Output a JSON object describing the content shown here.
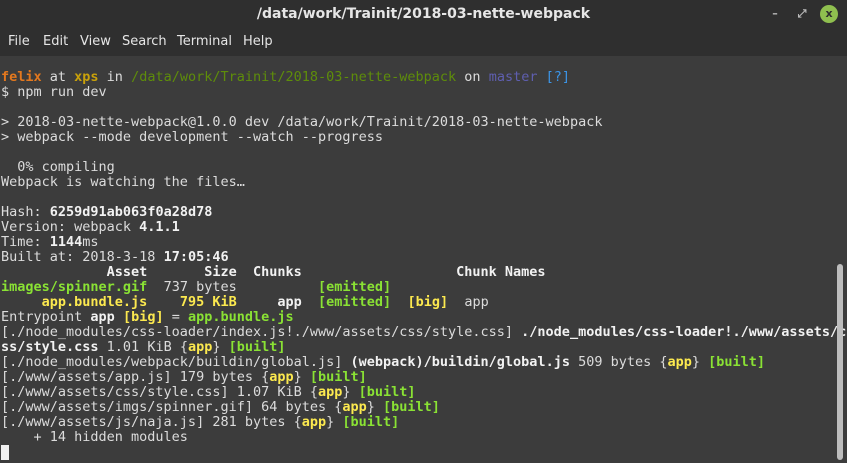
{
  "window": {
    "title": "/data/work/Trainit/2018-03-nette-webpack",
    "minimize": "–",
    "maximize": "⤢",
    "close": "x"
  },
  "menu": [
    "File",
    "Edit",
    "View",
    "Search",
    "Terminal",
    "Help"
  ],
  "colors": {
    "background": "#3c3c3c",
    "user": "#e3781e",
    "host": "#c9a10a",
    "path": "#5e8d0a",
    "branch": "#5f5fb0",
    "status": "#3b95e8",
    "green": "#8ae234",
    "yellow": "#fce94f"
  },
  "terminal": [
    [
      [
        "felix",
        "c-orange"
      ],
      [
        " at ",
        ""
      ],
      [
        "xps",
        "c-gold"
      ],
      [
        " in ",
        ""
      ],
      [
        "/data/work/Trainit/2018-03-nette-webpack",
        "c-path"
      ],
      [
        " on ",
        ""
      ],
      [
        "master",
        "c-purple"
      ],
      [
        " [?]",
        "c-blue"
      ]
    ],
    [
      [
        "$ npm run dev",
        ""
      ]
    ],
    [],
    [
      [
        "> 2018-03-nette-webpack@1.0.0 dev /data/work/Trainit/2018-03-nette-webpack",
        ""
      ]
    ],
    [
      [
        "> webpack --mode development --watch --progress",
        ""
      ]
    ],
    [],
    [
      [
        "  0% compiling",
        ""
      ]
    ],
    [
      [
        "Webpack is watching the files…",
        ""
      ]
    ],
    [],
    [
      [
        "Hash: ",
        ""
      ],
      [
        "6259d91ab063f0a28d78",
        "b"
      ]
    ],
    [
      [
        "Version: webpack ",
        ""
      ],
      [
        "4.1.1",
        "b"
      ]
    ],
    [
      [
        "Time: ",
        ""
      ],
      [
        "1144",
        "b"
      ],
      [
        "ms",
        ""
      ]
    ],
    [
      [
        "Built at: 2018-3-18 ",
        ""
      ],
      [
        "17:05:46",
        "b"
      ]
    ],
    [
      [
        "             Asset       Size  Chunks                   Chunk Names",
        "b"
      ]
    ],
    [
      [
        "images/spinner.gif",
        "c-greenb"
      ],
      [
        "  737 bytes          ",
        ""
      ],
      [
        "[emitted]",
        "c-greenb"
      ]
    ],
    [
      [
        "     app.bundle.js",
        "c-yellowb"
      ],
      [
        "    ",
        ""
      ],
      [
        "795 KiB",
        "c-yellowb"
      ],
      [
        "     ",
        ""
      ],
      [
        "app",
        "b"
      ],
      [
        "  ",
        ""
      ],
      [
        "[emitted]",
        "c-greenb"
      ],
      [
        "  ",
        ""
      ],
      [
        "[big]",
        "c-yellowb"
      ],
      [
        "  app",
        ""
      ]
    ],
    [
      [
        "Entrypoint ",
        ""
      ],
      [
        "app",
        "b"
      ],
      [
        " ",
        ""
      ],
      [
        "[big]",
        "c-yellowb"
      ],
      [
        " = ",
        ""
      ],
      [
        "app.bundle.js",
        "c-greenb"
      ]
    ],
    [
      [
        "[./node_modules/css-loader/index.js!./www/assets/css/style.css] ",
        ""
      ],
      [
        "./node_modules/css-loader!./www/assets/c",
        "b"
      ]
    ],
    [
      [
        "ss/style.css",
        "b"
      ],
      [
        " 1.01 KiB {",
        ""
      ],
      [
        "app",
        "c-yellowb"
      ],
      [
        "} ",
        ""
      ],
      [
        "[built]",
        "c-greenb"
      ]
    ],
    [
      [
        "[./node_modules/webpack/buildin/global.js] ",
        ""
      ],
      [
        "(webpack)/buildin/global.js",
        "b"
      ],
      [
        " 509 bytes {",
        ""
      ],
      [
        "app",
        "c-yellowb"
      ],
      [
        "} ",
        ""
      ],
      [
        "[built]",
        "c-greenb"
      ]
    ],
    [
      [
        "[./www/assets/app.js] 179 bytes {",
        ""
      ],
      [
        "app",
        "c-yellowb"
      ],
      [
        "} ",
        ""
      ],
      [
        "[built]",
        "c-greenb"
      ]
    ],
    [
      [
        "[./www/assets/css/style.css] 1.07 KiB {",
        ""
      ],
      [
        "app",
        "c-yellowb"
      ],
      [
        "} ",
        ""
      ],
      [
        "[built]",
        "c-greenb"
      ]
    ],
    [
      [
        "[./www/assets/imgs/spinner.gif] 64 bytes {",
        ""
      ],
      [
        "app",
        "c-yellowb"
      ],
      [
        "} ",
        ""
      ],
      [
        "[built]",
        "c-greenb"
      ]
    ],
    [
      [
        "[./www/assets/js/naja.js] 281 bytes {",
        ""
      ],
      [
        "app",
        "c-yellowb"
      ],
      [
        "} ",
        ""
      ],
      [
        "[built]",
        "c-greenb"
      ]
    ],
    [
      [
        "    + 14 hidden modules",
        ""
      ]
    ]
  ]
}
